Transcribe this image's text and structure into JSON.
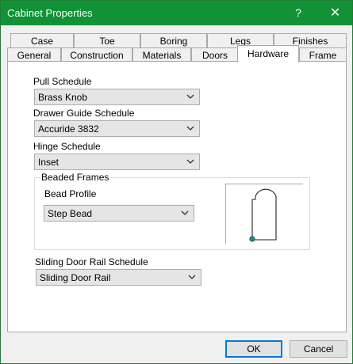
{
  "window": {
    "title": "Cabinet Properties",
    "help_glyph": "?",
    "close_glyph": "✕"
  },
  "tabs_row1": [
    {
      "label": "Case"
    },
    {
      "label": "Toe"
    },
    {
      "label": "Boring"
    },
    {
      "label": "Legs"
    },
    {
      "label": "Finishes"
    }
  ],
  "tabs_row2": [
    {
      "label": "General"
    },
    {
      "label": "Construction"
    },
    {
      "label": "Materials"
    },
    {
      "label": "Doors"
    },
    {
      "label": "Hardware",
      "selected": true
    },
    {
      "label": "Frame"
    }
  ],
  "hardware": {
    "pull_schedule": {
      "label": "Pull Schedule",
      "value": "Brass Knob"
    },
    "drawer_guide_schedule": {
      "label": "Drawer Guide Schedule",
      "value": "Accuride 3832"
    },
    "hinge_schedule": {
      "label": "Hinge Schedule",
      "value": "Inset"
    },
    "beaded_frames": {
      "legend": "Beaded Frames",
      "bead_profile": {
        "label": "Bead Profile",
        "value": "Step Bead"
      }
    },
    "sliding_door_rail_schedule": {
      "label": "Sliding Door Rail Schedule",
      "value": "Sliding Door Rail"
    }
  },
  "buttons": {
    "ok": "OK",
    "cancel": "Cancel"
  },
  "colors": {
    "titlebar": "#119237",
    "accent_border": "#0078d7",
    "preview_node": "#1a8f86"
  }
}
